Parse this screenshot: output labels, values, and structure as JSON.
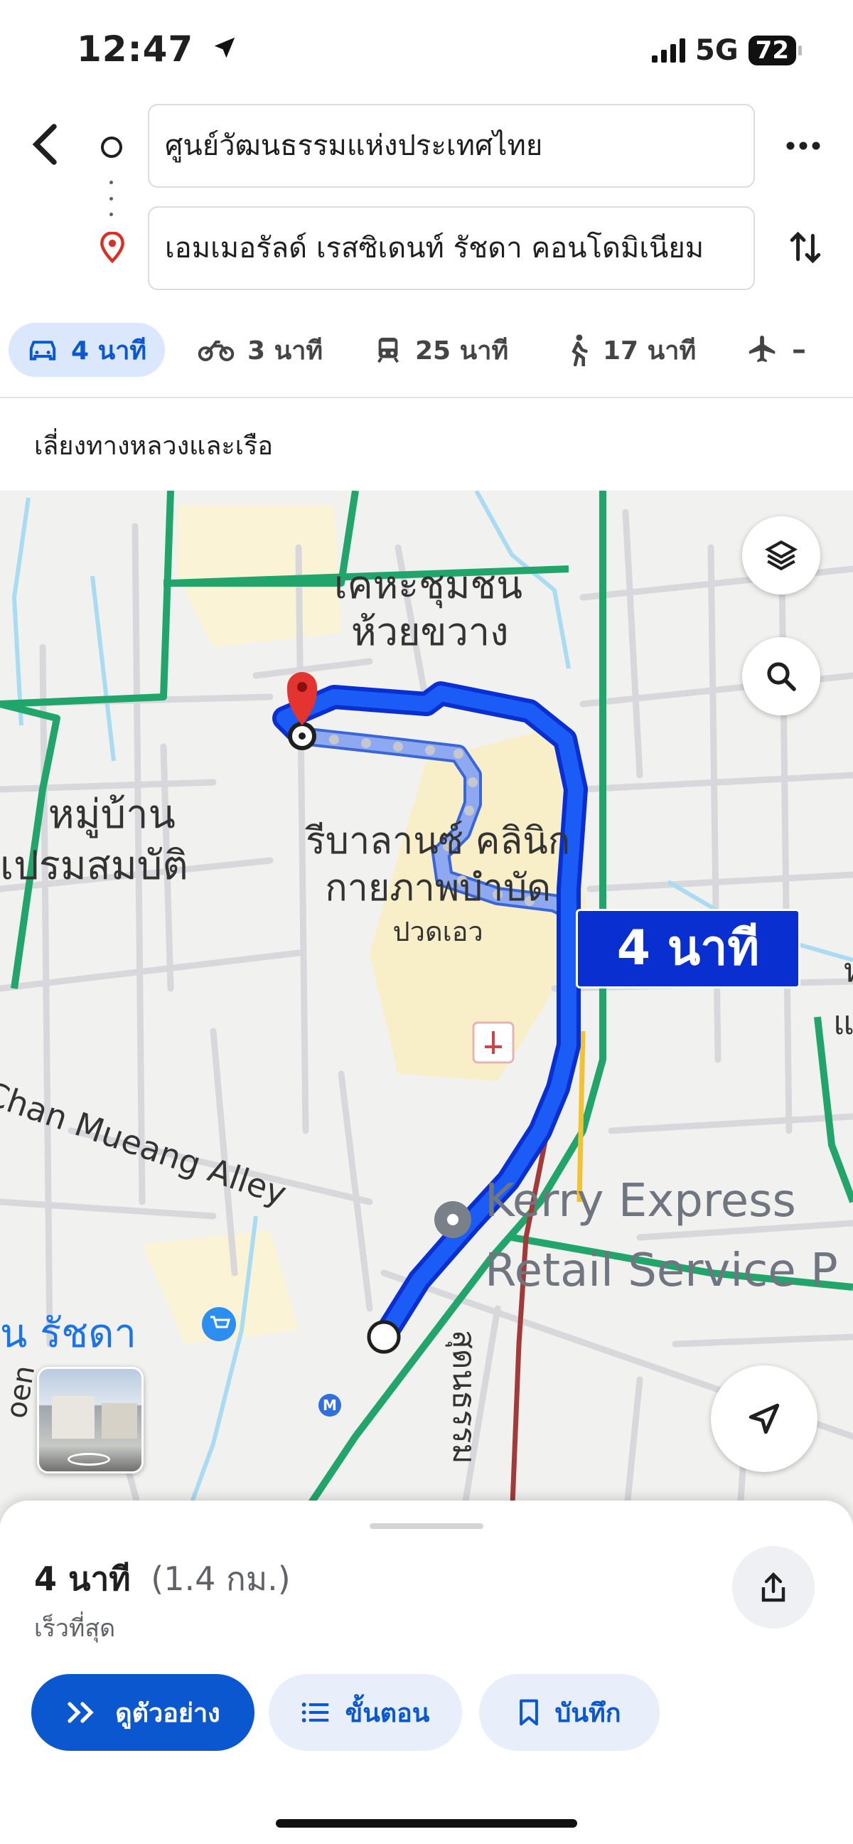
{
  "status": {
    "time": "12:47",
    "network": "5G",
    "battery": "72"
  },
  "route": {
    "origin": "ศูนย์วัฒนธรรมแห่งประเทศไทย",
    "destination": "เอมเมอรัลด์ เรสซิเดนท์ รัชดา คอนโดมิเนียม"
  },
  "modes": [
    {
      "icon": "car-icon",
      "label": "4 นาที",
      "active": true
    },
    {
      "icon": "motorbike-icon",
      "label": "3 นาที"
    },
    {
      "icon": "transit-icon",
      "label": "25 นาที"
    },
    {
      "icon": "walk-icon",
      "label": "17 นาที"
    },
    {
      "icon": "flight-icon",
      "label": "–"
    }
  ],
  "notice": "เลี่ยงทางหลวงและเรือ",
  "map": {
    "labels": {
      "community_line1": "เคหะชุมชน",
      "community_line2": "ห้วยขวาง",
      "village_line1": "หมู่บ้าน",
      "village_line2": "เปรมสมบัติ",
      "clinic_line1": "รีบาลานซ์ คลินิก",
      "clinic_line2": "กายภาพบำบัด",
      "clinic_line3": "ปวดเอว",
      "alley": "Chan Mueang Alley",
      "kerry_line1": "Kerry Express",
      "kerry_line2": "Retail Service P",
      "shop": "ิน รัชดา",
      "road": "สุดนธรรม",
      "edge1": "ห",
      "edge2": "แ",
      "metro": "M",
      "street_fragment": "oen"
    },
    "route_badge": "4 นาที",
    "colors": {
      "route": "#0b3fe6",
      "route_alt": "#8ea9f0",
      "green": "#21a56a",
      "badge": "#0a2fd0"
    }
  },
  "summary": {
    "duration": "4 นาที",
    "distance": "(1.4 กม.)",
    "note": "เร็วที่สุด"
  },
  "actions": {
    "preview": "ดูตัวอย่าง",
    "steps": "ขั้นตอน",
    "save": "บันทึก"
  }
}
